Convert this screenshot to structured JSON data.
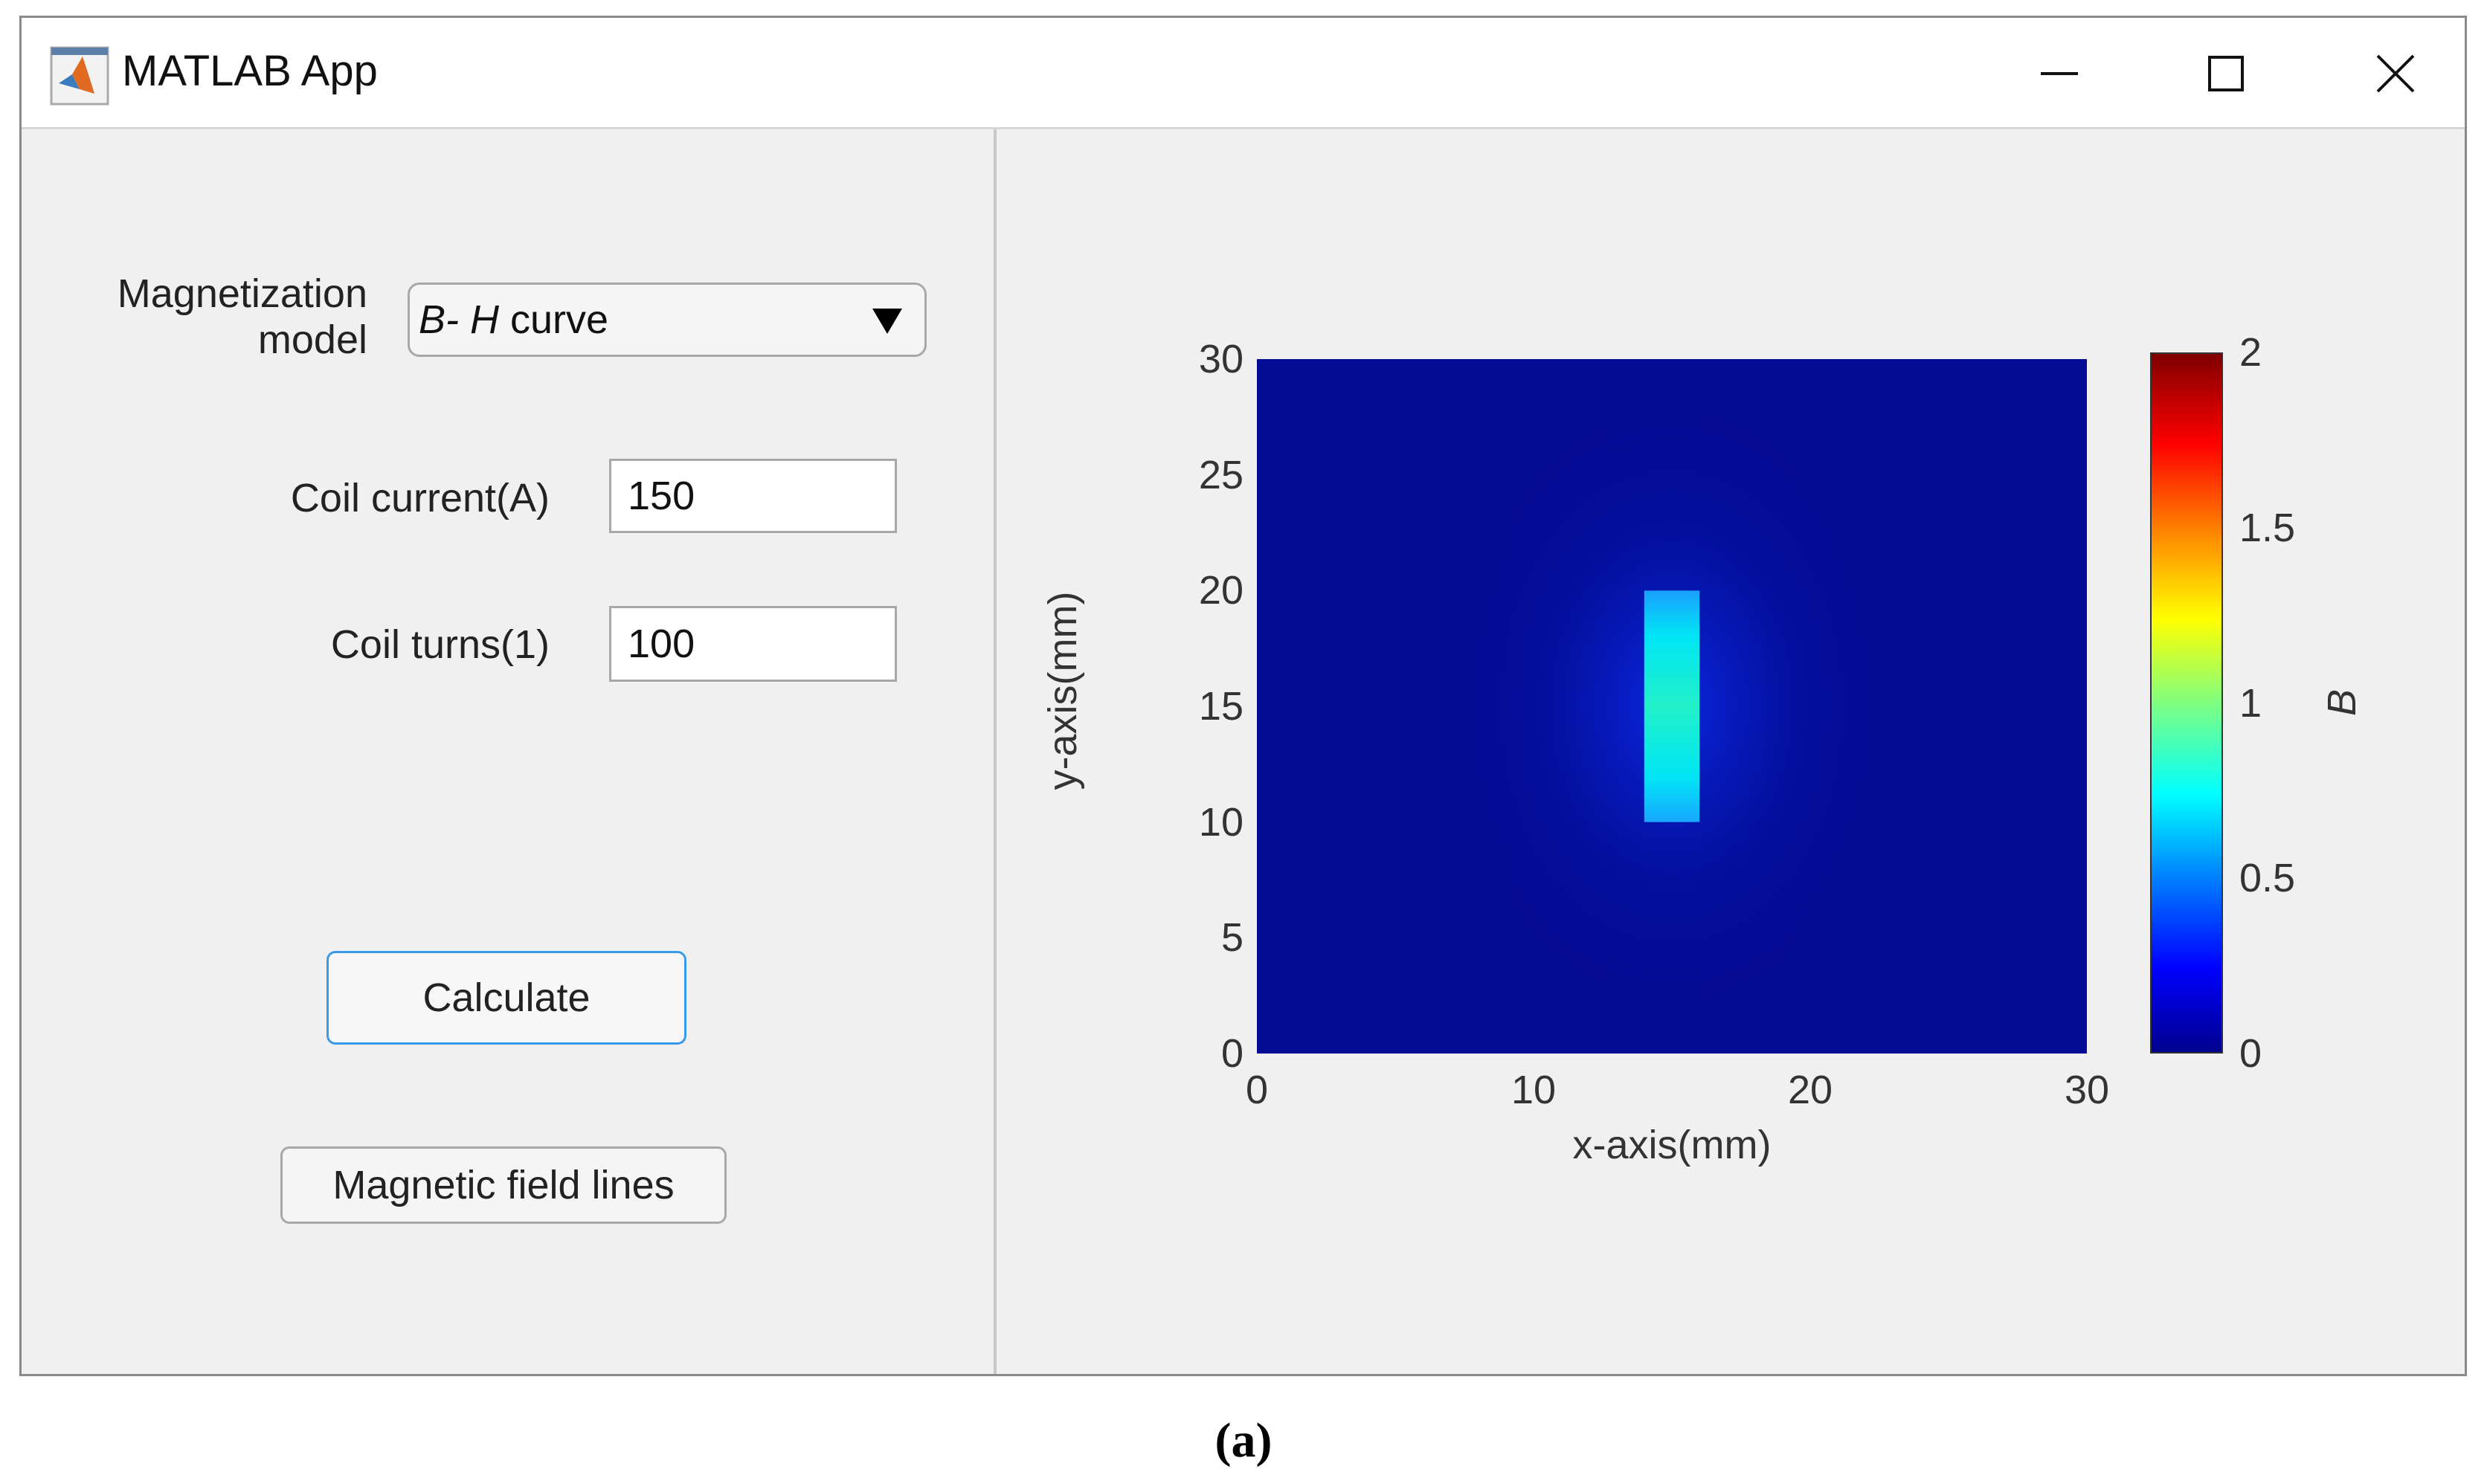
{
  "window": {
    "title": "MATLAB App"
  },
  "controls": {
    "model_label_line1": "Magnetization",
    "model_label_line2": "model",
    "model_value_italic": "B- H",
    "model_value_rest": " curve",
    "current_label": "Coil current(A)",
    "current_value": "150",
    "turns_label": "Coil turns(1)",
    "turns_value": "100",
    "calculate_label": "Calculate",
    "field_lines_label": "Magnetic field lines"
  },
  "chart_data": {
    "type": "heatmap",
    "xlabel": "x-axis(mm)",
    "ylabel": "y-axis(mm)",
    "xlim": [
      0,
      30
    ],
    "ylim": [
      0,
      30
    ],
    "xticks": [
      "0",
      "10",
      "20",
      "30"
    ],
    "yticks": [
      "0",
      "5",
      "10",
      "15",
      "20",
      "25",
      "30"
    ],
    "colormap": "jet",
    "colorbar": {
      "label": "B",
      "range": [
        0,
        2
      ],
      "ticks": [
        "0",
        "0.5",
        "1",
        "1.5",
        "2"
      ]
    },
    "region": {
      "x": [
        14,
        16
      ],
      "y": [
        10,
        20
      ],
      "value_center": 0.85,
      "value_ends": 0.7
    },
    "background_value": 0.05
  },
  "caption": "(a)"
}
